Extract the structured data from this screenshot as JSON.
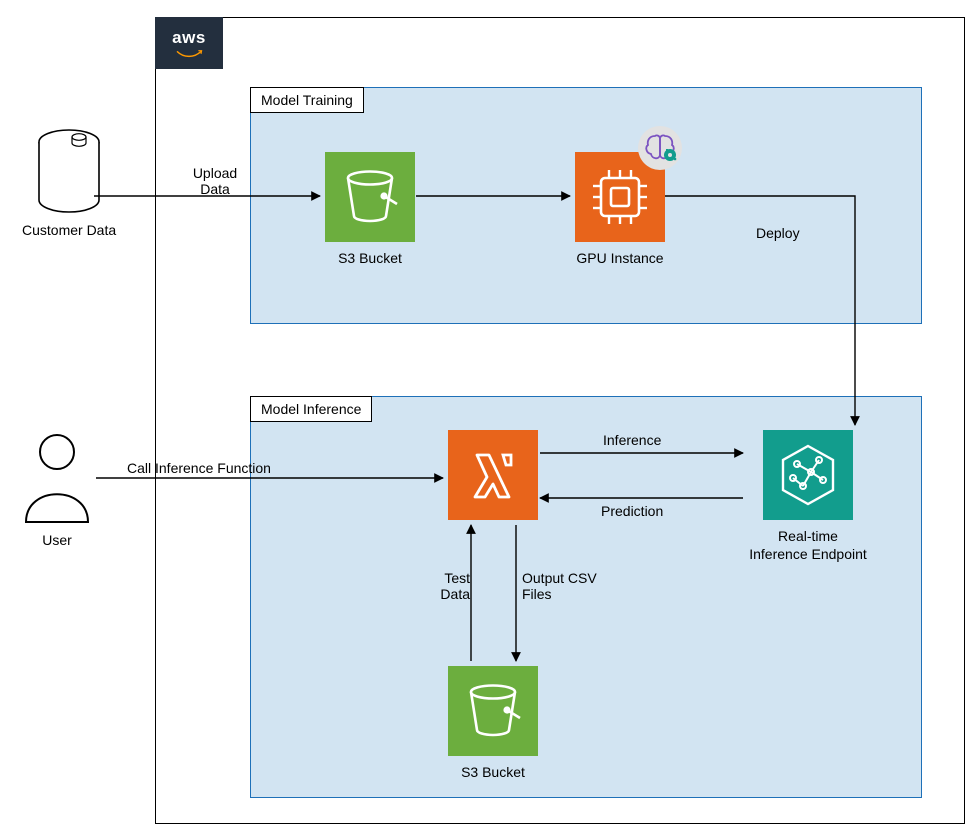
{
  "cloud": {
    "logo": "aws"
  },
  "groups": {
    "training": {
      "title": "Model Training"
    },
    "inference": {
      "title": "Model Inference"
    }
  },
  "external": {
    "customer_data": {
      "label": "Customer Data"
    },
    "user": {
      "label": "User"
    }
  },
  "nodes": {
    "s3_train": {
      "label": "S3 Bucket",
      "service": "s3"
    },
    "gpu": {
      "label": "GPU Instance",
      "service": "ec2-gpu",
      "decorator": "brain"
    },
    "lambda": {
      "label": "",
      "service": "lambda"
    },
    "endpoint": {
      "label": "Real-time Inference Endpoint",
      "service": "sagemaker-endpoint"
    },
    "s3_inf": {
      "label": "S3 Bucket",
      "service": "s3"
    }
  },
  "edges": {
    "upload": {
      "label": "Upload Data",
      "from": "customer_data",
      "to": "s3_train"
    },
    "to_gpu": {
      "label": "",
      "from": "s3_train",
      "to": "gpu"
    },
    "deploy": {
      "label": "Deploy",
      "from": "gpu",
      "to": "endpoint"
    },
    "call_fn": {
      "label": "Call Inference Function",
      "from": "user",
      "to": "lambda"
    },
    "inference": {
      "label": "Inference",
      "from": "lambda",
      "to": "endpoint"
    },
    "prediction": {
      "label": "Prediction",
      "from": "endpoint",
      "to": "lambda"
    },
    "test_data": {
      "label": "Test Data",
      "from": "s3_inf",
      "to": "lambda"
    },
    "output_csv": {
      "label": "Output CSV Files",
      "from": "lambda",
      "to": "s3_inf"
    }
  }
}
